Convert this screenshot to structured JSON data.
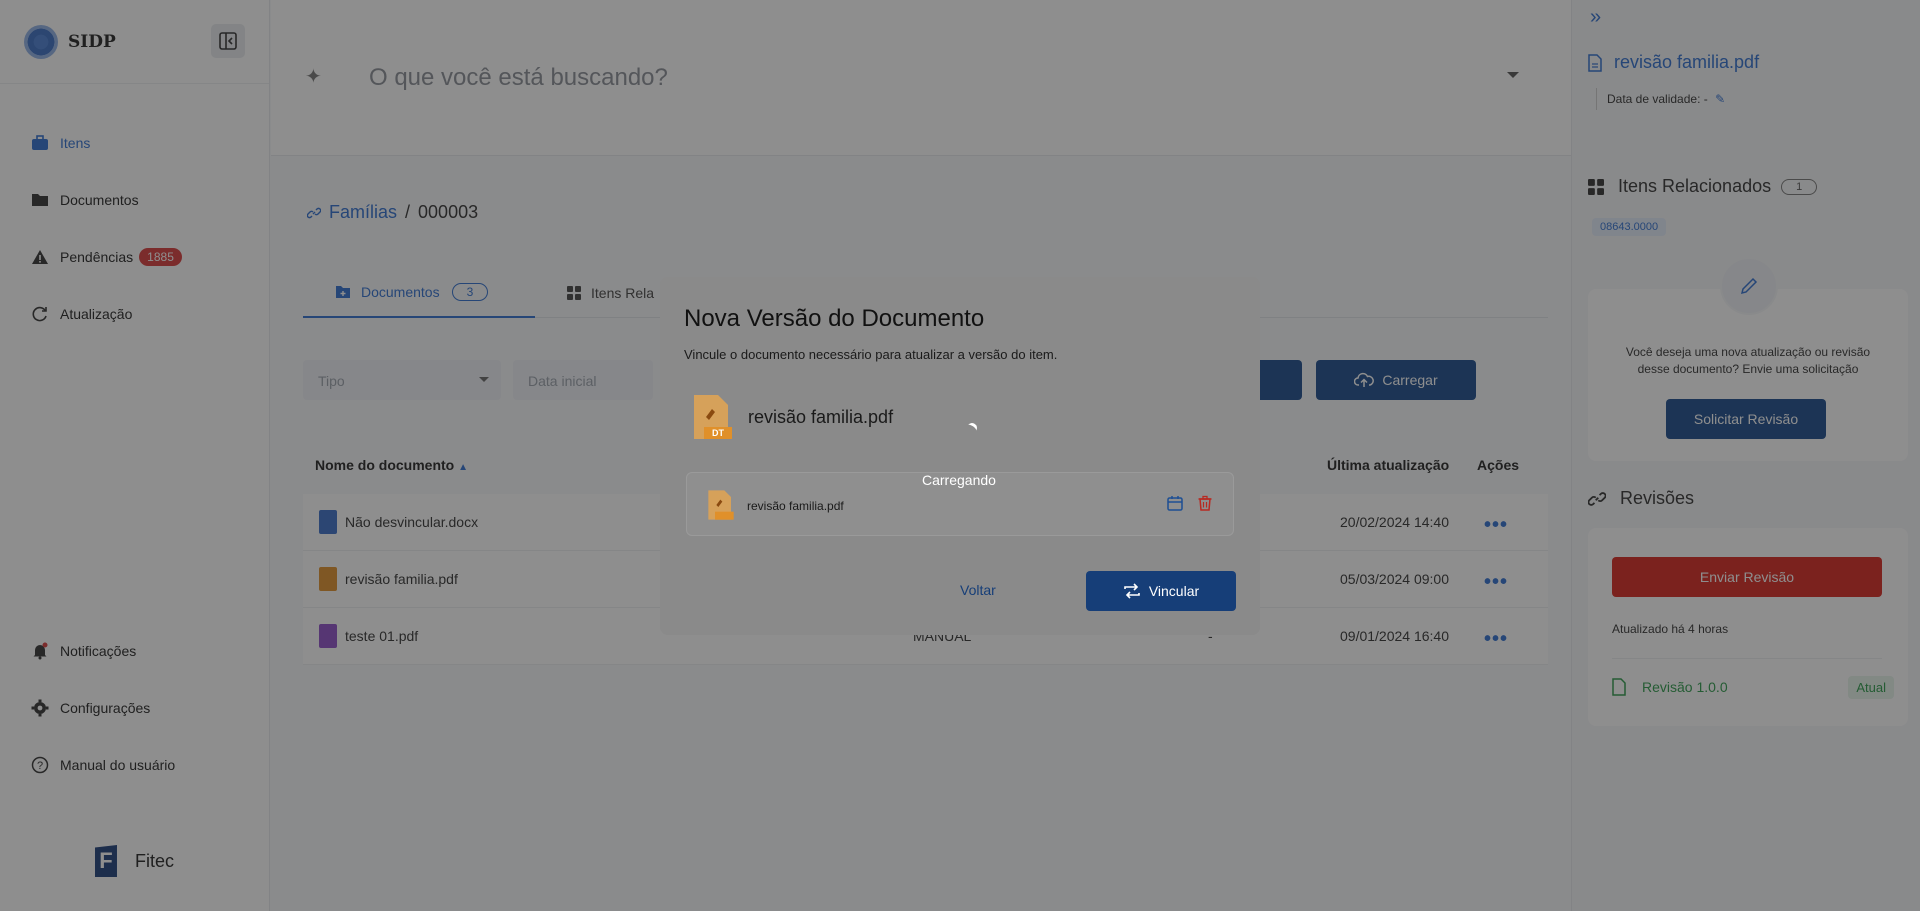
{
  "app": {
    "brand": "SIDP",
    "footer_brand": "Fitec"
  },
  "sidebar": {
    "items": [
      {
        "label": "Itens",
        "icon": "briefcase-icon",
        "active": true
      },
      {
        "label": "Documentos",
        "icon": "folder-icon"
      },
      {
        "label": "Pendências",
        "icon": "warning-icon",
        "badge": "1885"
      },
      {
        "label": "Atualização",
        "icon": "refresh-icon"
      }
    ],
    "bottom_items": [
      {
        "label": "Notificações",
        "icon": "bell-icon"
      },
      {
        "label": "Configurações",
        "icon": "gear-icon"
      },
      {
        "label": "Manual do usuário",
        "icon": "help-icon"
      }
    ]
  },
  "search": {
    "placeholder": "O que você está buscando?"
  },
  "breadcrumb": {
    "parent": "Famílias",
    "separator": "/",
    "current": "000003"
  },
  "tabs": [
    {
      "label": "Documentos",
      "count": "3"
    },
    {
      "label": "Itens Rela"
    }
  ],
  "filters": {
    "type_placeholder": "Tipo",
    "date_placeholder": "Data inicial"
  },
  "toolbar": {
    "upload_label": "Carregar"
  },
  "table": {
    "headers": {
      "name": "Nome do documento",
      "updated": "Última atualização",
      "actions": "Ações"
    },
    "rows": [
      {
        "name": "Não desvincular.docx",
        "mid": "",
        "dash": "",
        "updated": "20/02/2024 14:40",
        "icon_color": "#3b6fc9"
      },
      {
        "name": "revisão familia.pdf",
        "mid": "",
        "dash": "",
        "updated": "05/03/2024 09:00",
        "icon_color": "#e0902a"
      },
      {
        "name": "teste 01.pdf",
        "mid": "MANUAL",
        "dash": "-",
        "updated": "09/01/2024 16:40",
        "icon_color": "#8e4fc9"
      }
    ]
  },
  "right_panel": {
    "doc_name": "revisão familia.pdf",
    "validity_label": "Data de validade: -",
    "related_title": "Itens Relacionados",
    "related_count": "1",
    "related_tag": "08643.0000",
    "request_text": "Você deseja uma nova atualização ou revisão desse documento? Envie uma solicitação",
    "request_button": "Solicitar Revisão",
    "revisions_title": "Revisões",
    "send_revision_button": "Enviar Revisão",
    "updated_ago": "Atualizado há 4 horas",
    "revision_name": "Revisão 1.0.0",
    "revision_tag": "Atual"
  },
  "modal": {
    "title": "Nova Versão do Documento",
    "subtitle": "Vincule o documento necessário para atualizar a versão do item.",
    "file_name": "revisão familia.pdf",
    "file_badge": "DT",
    "attached_name": "revisão familia.pdf",
    "loading_text": "Carregando",
    "back_label": "Voltar",
    "link_label": "Vincular"
  },
  "colors": {
    "primary": "#2f6fd1",
    "dark_button": "#1a4b8c",
    "danger": "#d8261e",
    "badge": "#d83b3b",
    "success": "#2c9b4a"
  }
}
